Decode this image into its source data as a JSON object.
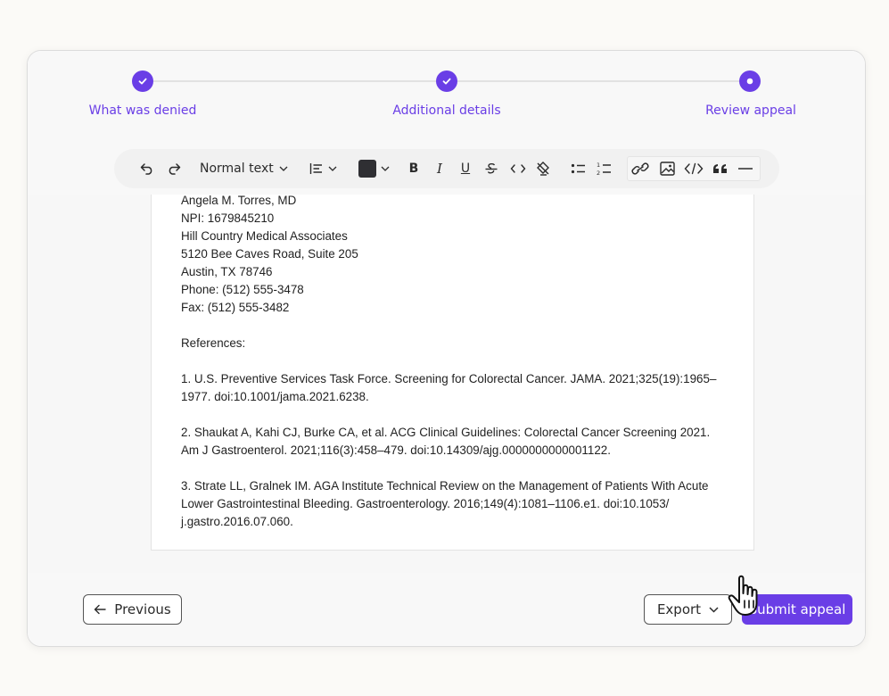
{
  "stepper": {
    "steps": [
      {
        "label": "What was denied",
        "state": "complete"
      },
      {
        "label": "Additional details",
        "state": "complete"
      },
      {
        "label": "Review appeal",
        "state": "current"
      }
    ]
  },
  "toolbar": {
    "block_style": "Normal text",
    "text_color": "#2f2f33",
    "tools": [
      "undo-icon",
      "redo-icon",
      "block-style-dropdown",
      "align-dropdown",
      "color-dropdown",
      "bold",
      "italic",
      "underline",
      "strikethrough",
      "inline-code",
      "clear-format",
      "bullet-list",
      "numbered-list",
      "link",
      "image",
      "code-block",
      "blockquote",
      "horizontal-rule"
    ],
    "bold_label": "B",
    "italic_label": "I",
    "underline_label": "U"
  },
  "document": {
    "signature_lines": [
      "Angela M. Torres, MD",
      "NPI: 1679845210",
      "Hill Country Medical Associates",
      "5120 Bee Caves Road, Suite 205",
      "Austin, TX 78746",
      "Phone: (512) 555-3478",
      "Fax: (512) 555-3482"
    ],
    "references_heading": "References:",
    "references": [
      [
        "1. U.S. Preventive Services Task Force. Screening for Colorectal Cancer. JAMA. 2021;325(19):1965–",
        "1977. doi:10.1001/jama.2021.6238."
      ],
      [
        "2. Shaukat A, Kahi CJ, Burke CA, et al. ACG Clinical Guidelines: Colorectal Cancer Screening 2021.",
        "Am J Gastroenterol. 2021;116(3):458–479. doi:10.14309/ajg.0000000000001122."
      ],
      [
        "3. Strate LL, Gralnek IM. AGA Institute Technical Review on the Management of Patients With Acute",
        "Lower Gastrointestinal Bleeding. Gastroenterology. 2016;149(4):1081–1106.e1. doi:10.1053/",
        "j.gastro.2016.07.060."
      ]
    ]
  },
  "footer": {
    "previous_label": "Previous",
    "export_label": "Export",
    "submit_label": "Submit appeal"
  },
  "colors": {
    "accent": "#6a3ee6"
  }
}
